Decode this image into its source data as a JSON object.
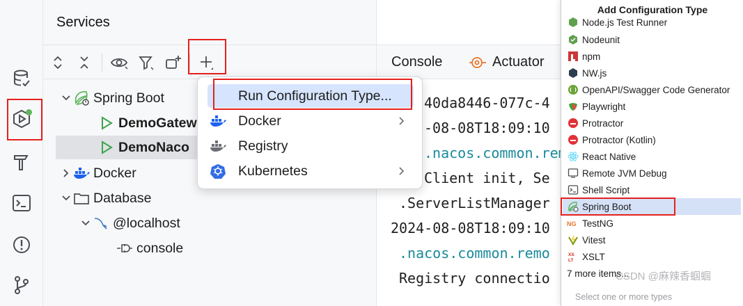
{
  "services": {
    "title": "Services",
    "tree": [
      {
        "label": "Spring Boot",
        "bold": false
      },
      {
        "label": "DemoGatew",
        "bold": true
      },
      {
        "label": "DemoNaco",
        "bold": true
      },
      {
        "label": "Docker",
        "bold": false
      },
      {
        "label": "Database",
        "bold": false
      },
      {
        "label": "@localhost",
        "bold": false
      },
      {
        "label": "console",
        "bold": false
      }
    ]
  },
  "console": {
    "tabs": [
      "Console",
      "Actuator"
    ],
    "lines": [
      {
        "text": "40da8446-077c-4",
        "teal": false
      },
      {
        "text": "-08-08T18:09:10",
        "teal": false
      },
      {
        "text": ".nacos.common.remo",
        "teal": true
      },
      {
        "text": "Client init, Se",
        "teal": false
      },
      {
        "text": ".ServerListManager",
        "teal": false
      },
      {
        "text": "2024-08-08T18:09:10",
        "teal": false
      },
      {
        "text": ".nacos.common.remo",
        "teal": true
      },
      {
        "text": "Registry connectio",
        "teal": false
      }
    ]
  },
  "popup": {
    "items": [
      {
        "label": "Run Configuration Type...",
        "icon": "none",
        "has_submenu": false
      },
      {
        "label": "Docker",
        "icon": "docker-icon",
        "has_submenu": true
      },
      {
        "label": "Registry",
        "icon": "registry-icon",
        "has_submenu": false
      },
      {
        "label": "Kubernetes",
        "icon": "kubernetes-icon",
        "has_submenu": true
      }
    ]
  },
  "add_config": {
    "title": "Add Configuration Type",
    "items": [
      {
        "label": "Node.js Test Runner",
        "icon": "nodejs-icon"
      },
      {
        "label": "Nodeunit",
        "icon": "nodeunit-icon"
      },
      {
        "label": "npm",
        "icon": "npm-icon"
      },
      {
        "label": "NW.js",
        "icon": "nwjs-icon"
      },
      {
        "label": "OpenAPI/Swagger Code Generator",
        "icon": "openapi-icon"
      },
      {
        "label": "Playwright",
        "icon": "playwright-icon"
      },
      {
        "label": "Protractor",
        "icon": "protractor-icon"
      },
      {
        "label": "Protractor (Kotlin)",
        "icon": "protractor-kotlin-icon"
      },
      {
        "label": "React Native",
        "icon": "react-icon"
      },
      {
        "label": "Remote JVM Debug",
        "icon": "remote-debug-icon"
      },
      {
        "label": "Shell Script",
        "icon": "shell-icon"
      },
      {
        "label": "Spring Boot",
        "icon": "spring-boot-icon"
      },
      {
        "label": "TestNG",
        "icon": "testng-icon"
      },
      {
        "label": "Vitest",
        "icon": "vitest-icon"
      },
      {
        "label": "XSLT",
        "icon": "xslt-icon"
      }
    ],
    "selected": "Spring Boot",
    "more": "7 more items...",
    "search_hint": "Select one or more types",
    "watermark": "CSDN @麻辣香蝈蝈"
  },
  "colors": {
    "highlight_red": "#e5201d",
    "selection_blue": "#d6e4fd",
    "spring_green": "#5fb85f",
    "run_green": "#3fa34d"
  }
}
